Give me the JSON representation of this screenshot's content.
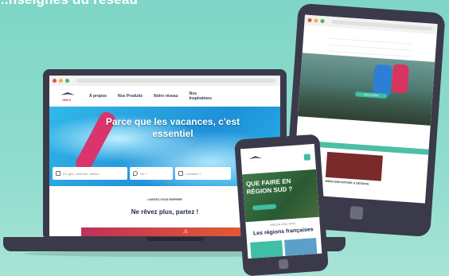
{
  "headline": "...nseignes du réseau",
  "laptop": {
    "nav": {
      "logo_text": "UNCV",
      "items": [
        "À propos",
        "Nos Produits",
        "Notre réseau",
        "Nos Inspirations"
      ]
    },
    "hero": {
      "title": "Parce que les vacances, c'est essentiel",
      "search": {
        "field1": "Ex: gîte, chambre, thème...",
        "field2": "Où ?",
        "field3": "Combien ?"
      }
    },
    "inspire": {
      "small": "LAISSEZ-VOUS INSPIRER",
      "title": "Ne rêvez plus, partez !"
    },
    "warning_icon": "warning-icon"
  },
  "tablet": {
    "photo_button": "DÉCOUVRIR",
    "card_label": "WEEK-END NATURE & DÉTENTE"
  },
  "phone": {
    "hero_title": "QUE FAIRE EN RÉGION SUD ?",
    "small": "PRÈS DE CHEZ VOUS",
    "section_title": "Les régions françaises"
  },
  "colors": {
    "background": "#8fdcce",
    "device": "#3b3a4a",
    "accent": "#3fbfa3",
    "hero_title": "#ffffff"
  }
}
